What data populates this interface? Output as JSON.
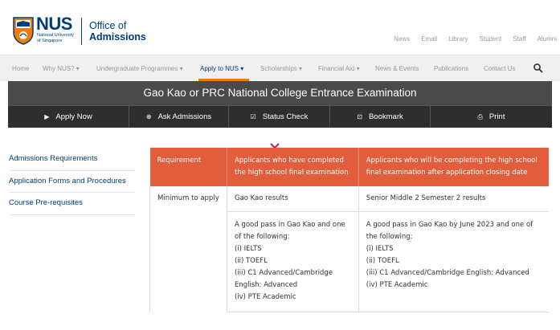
{
  "header": {
    "logo_text": "NUS",
    "logo_subtitle_line1": "National University",
    "logo_subtitle_line2": "of Singapore",
    "office_line1": "Office of",
    "office_line2": "Admissions",
    "utility_links": [
      "News",
      "Email",
      "Library",
      "Student",
      "Staff",
      "Alumni"
    ]
  },
  "nav": {
    "items": [
      {
        "label": "Home",
        "active": false
      },
      {
        "label": "Why NUS? ▾",
        "active": false
      },
      {
        "label": "Undergraduate Programmes ▾",
        "active": false
      },
      {
        "label": "Apply to NUS ▾",
        "active": true
      },
      {
        "label": "Scholarships ▾",
        "active": false
      },
      {
        "label": "Financial Aid ▾",
        "active": false
      },
      {
        "label": "News & Events",
        "active": false
      },
      {
        "label": "Publications",
        "active": false
      },
      {
        "label": "Contact Us",
        "active": false
      }
    ],
    "search_icon": "search-icon"
  },
  "page_title": "Gao Kao or PRC National College Entrance Examination",
  "actions": [
    {
      "label": "Apply Now",
      "icon": "▶"
    },
    {
      "label": "Ask Admissions",
      "icon": "⊕"
    },
    {
      "label": "Status Check",
      "icon": "☑"
    },
    {
      "label": "Bookmark",
      "icon": "⊡"
    },
    {
      "label": "Print",
      "icon": "⎙"
    }
  ],
  "sidebar": {
    "items": [
      {
        "label": "Admissions Requirements"
      },
      {
        "label": "Application Forms and Procedures"
      },
      {
        "label": "Course Pre-requisites"
      }
    ]
  },
  "table": {
    "headers": [
      "Requirement",
      "Applicants who have completed the high school final examination",
      "Applicants who will be completing the high school final examination after application closing date"
    ],
    "row_label": "Minimum to apply",
    "results_completed": "Gao Kao results",
    "results_upcoming": "Senior Middle 2 Semester 2 results",
    "pass_completed": [
      "A good pass in Gao Kao and one of the following:",
      "(i) IELTS",
      "(ii) TOEFL",
      "(iii) C1 Advanced/Cambridge English: Advanced",
      "(iv) PTE Academic"
    ],
    "pass_upcoming": [
      "A good pass in Gao Kao by June 2023 and one of the following:",
      "(i) IELTS",
      "(ii) TOEFL",
      "(iii) C1 Advanced/Cambridge English: Advanced",
      "(iv) PTE Academic"
    ]
  },
  "colors": {
    "brand_blue": "#003d7c",
    "accent_orange": "#ef7c00",
    "table_header": "#e15d3c",
    "title_bar": "#4a4a4a",
    "action_bar": "#2e2e2e"
  }
}
